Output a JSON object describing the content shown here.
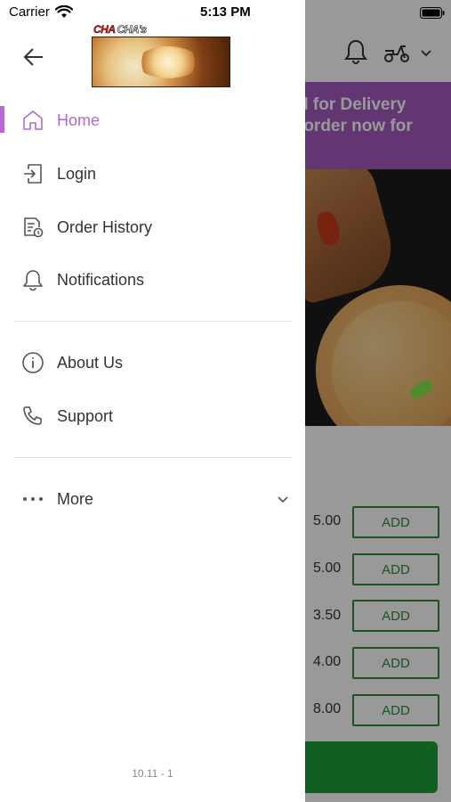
{
  "status_bar": {
    "carrier": "Carrier",
    "time": "5:13 PM"
  },
  "drawer": {
    "logo_text_red": "CHA",
    "logo_text_white": "CHA's",
    "menu": [
      {
        "label": "Home",
        "icon": "home-icon",
        "active": true
      },
      {
        "label": "Login",
        "icon": "login-icon",
        "active": false
      },
      {
        "label": "Order History",
        "icon": "order-history-icon",
        "active": false
      },
      {
        "label": "Notifications",
        "icon": "bell-icon",
        "active": false
      },
      {
        "label": "About Us",
        "icon": "info-icon",
        "active": false
      },
      {
        "label": "Support",
        "icon": "phone-icon",
        "active": false
      },
      {
        "label": "More",
        "icon": "more-dots-icon",
        "active": false
      }
    ],
    "version": "10.11 - 1"
  },
  "background": {
    "banner_line1": "d for Delivery",
    "banner_line2": "-order now for",
    "items": [
      {
        "price": "5.00",
        "button": "ADD"
      },
      {
        "price": "5.00",
        "button": "ADD"
      },
      {
        "price": "3.50",
        "button": "ADD"
      },
      {
        "price": "4.00",
        "button": "ADD"
      },
      {
        "price": "8.00",
        "button": "ADD"
      }
    ]
  },
  "colors": {
    "accent": "#b06ad0",
    "banner": "#a35bc0",
    "add_green": "#2e8b3e",
    "cta_green": "#1f9e3a"
  }
}
